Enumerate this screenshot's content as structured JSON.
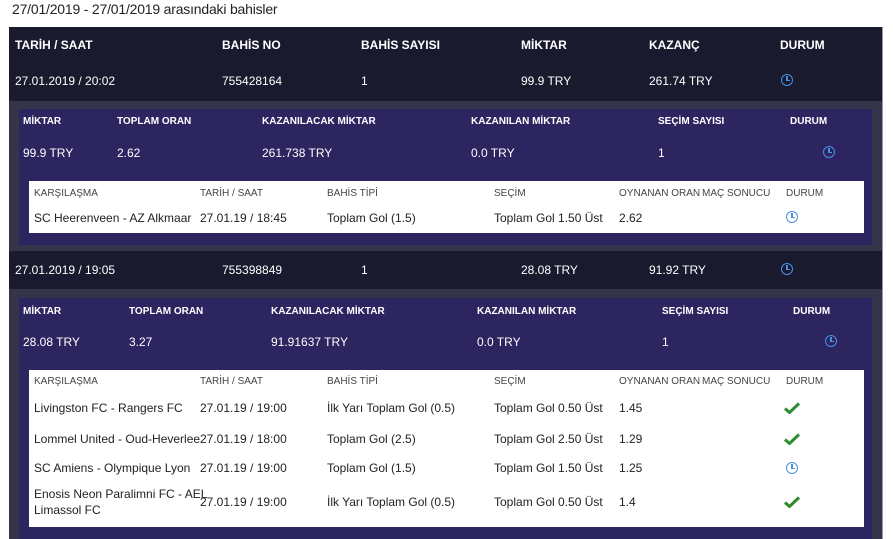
{
  "page": {
    "title": "27/01/2019 - 27/01/2019 arasındaki bahisler"
  },
  "table": {
    "headers": {
      "date_time": "TARİH / SAAT",
      "bet_no": "BAHİS NO",
      "bet_count": "BAHİS SAYISI",
      "amount": "MİKTAR",
      "winnings": "KAZANÇ",
      "status": "DURUM"
    },
    "detail_headers": {
      "amount": "MİKTAR",
      "total_odds": "TOPLAM ORAN",
      "to_win": "KAZANILACAK MİKTAR",
      "won": "KAZANILAN MİKTAR",
      "selection_count": "SEÇİM SAYISI",
      "status": "DURUM"
    },
    "match_headers": {
      "match": "KARŞILAŞMA",
      "date_time": "TARİH / SAAT",
      "bet_type": "BAHİS TİPİ",
      "selection": "SEÇİM",
      "played_odds": "OYNANAN ORAN",
      "match_result": "MAÇ SONUCU",
      "status": "DURUM"
    },
    "bets": [
      {
        "date_time": "27.01.2019 / 20:02",
        "bet_no": "755428164",
        "bet_count": "1",
        "amount": "99.9 TRY",
        "winnings": "261.74 TRY",
        "status_icon": "clock-icon",
        "detail": {
          "amount": "99.9 TRY",
          "total_odds": "2.62",
          "to_win": "261.738 TRY",
          "won": "0.0 TRY",
          "selection_count": "1",
          "status_icon": "clock-icon"
        },
        "matches": [
          {
            "match": "SC Heerenveen - AZ Alkmaar",
            "date_time": "27.01.19 / 18:45",
            "bet_type": "Toplam Gol (1.5)",
            "selection": "Toplam Gol 1.50 Üst",
            "odds": "2.62",
            "result": "",
            "status_icon": "clock-icon"
          }
        ]
      },
      {
        "date_time": "27.01.2019 / 19:05",
        "bet_no": "755398849",
        "bet_count": "1",
        "amount": "28.08 TRY",
        "winnings": "91.92 TRY",
        "status_icon": "clock-icon",
        "detail": {
          "amount": "28.08 TRY",
          "total_odds": "3.27",
          "to_win": "91.91637 TRY",
          "won": "0.0 TRY",
          "selection_count": "1",
          "status_icon": "clock-icon"
        },
        "matches": [
          {
            "match": "Livingston FC - Rangers FC",
            "date_time": "27.01.19 / 19:00",
            "bet_type": "İlk Yarı Toplam Gol (0.5)",
            "selection": "Toplam Gol 0.50 Üst",
            "odds": "1.45",
            "result": "",
            "status_icon": "check-icon"
          },
          {
            "match": "Lommel United - Oud-Heverlee",
            "date_time": "27.01.19 / 18:00",
            "bet_type": "Toplam Gol (2.5)",
            "selection": "Toplam Gol 2.50 Üst",
            "odds": "1.29",
            "result": "",
            "status_icon": "check-icon"
          },
          {
            "match": "SC Amiens - Olympique Lyon",
            "date_time": "27.01.19 / 19:00",
            "bet_type": "Toplam Gol (1.5)",
            "selection": "Toplam Gol 1.50 Üst",
            "odds": "1.25",
            "result": "",
            "status_icon": "clock-icon"
          },
          {
            "match_line1": "Enosis Neon Paralimni FC - AEL",
            "match_line2": "Limassol FC",
            "date_time": "27.01.19 / 19:00",
            "bet_type": "İlk Yarı Toplam Gol (0.5)",
            "selection": "Toplam Gol 0.50 Üst",
            "odds": "1.4",
            "result": "",
            "status_icon": "check-icon"
          }
        ]
      }
    ]
  },
  "colors": {
    "header_bg": "#1a1a2e",
    "panel_bg": "#34344a",
    "detail_bg": "#2c2560",
    "pending_icon": "#4a90e2",
    "won_icon": "#2e8b2e"
  }
}
